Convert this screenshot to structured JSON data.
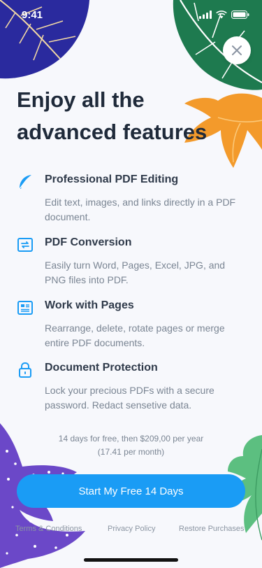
{
  "status_bar": {
    "time": "9:41"
  },
  "headline": {
    "line1": "Enjoy all the",
    "line2": "advanced features"
  },
  "features": [
    {
      "icon": "feather-icon",
      "title": "Professional PDF Editing",
      "description": "Edit text, images, and links directly in a PDF document."
    },
    {
      "icon": "conversion-icon",
      "title": "PDF Conversion",
      "description": "Easily turn Word, Pages, Excel, JPG, and PNG files into PDF."
    },
    {
      "icon": "pages-icon",
      "title": "Work with Pages",
      "description": "Rearrange, delete, rotate pages or merge entire PDF documents."
    },
    {
      "icon": "lock-icon",
      "title": "Document Protection",
      "description": "Lock your precious PDFs with a secure password. Redact sensetive data."
    }
  ],
  "pricing": {
    "line1": "14 days for free, then $209,00 per year",
    "line2": "(17.41 per month)"
  },
  "cta": {
    "label": "Start My Free 14 Days"
  },
  "footer": {
    "terms": "Terms & Conditions",
    "privacy": "Privacy Policy",
    "restore": "Restore Purchases"
  },
  "colors": {
    "accent": "#1a9cf5",
    "navy_leaf": "#2a2a9e",
    "green_leaf": "#1e7a4f",
    "orange_leaf": "#f39a2b",
    "purple_leaf": "#6b48c8",
    "light_green_leaf": "#5cbf80"
  }
}
